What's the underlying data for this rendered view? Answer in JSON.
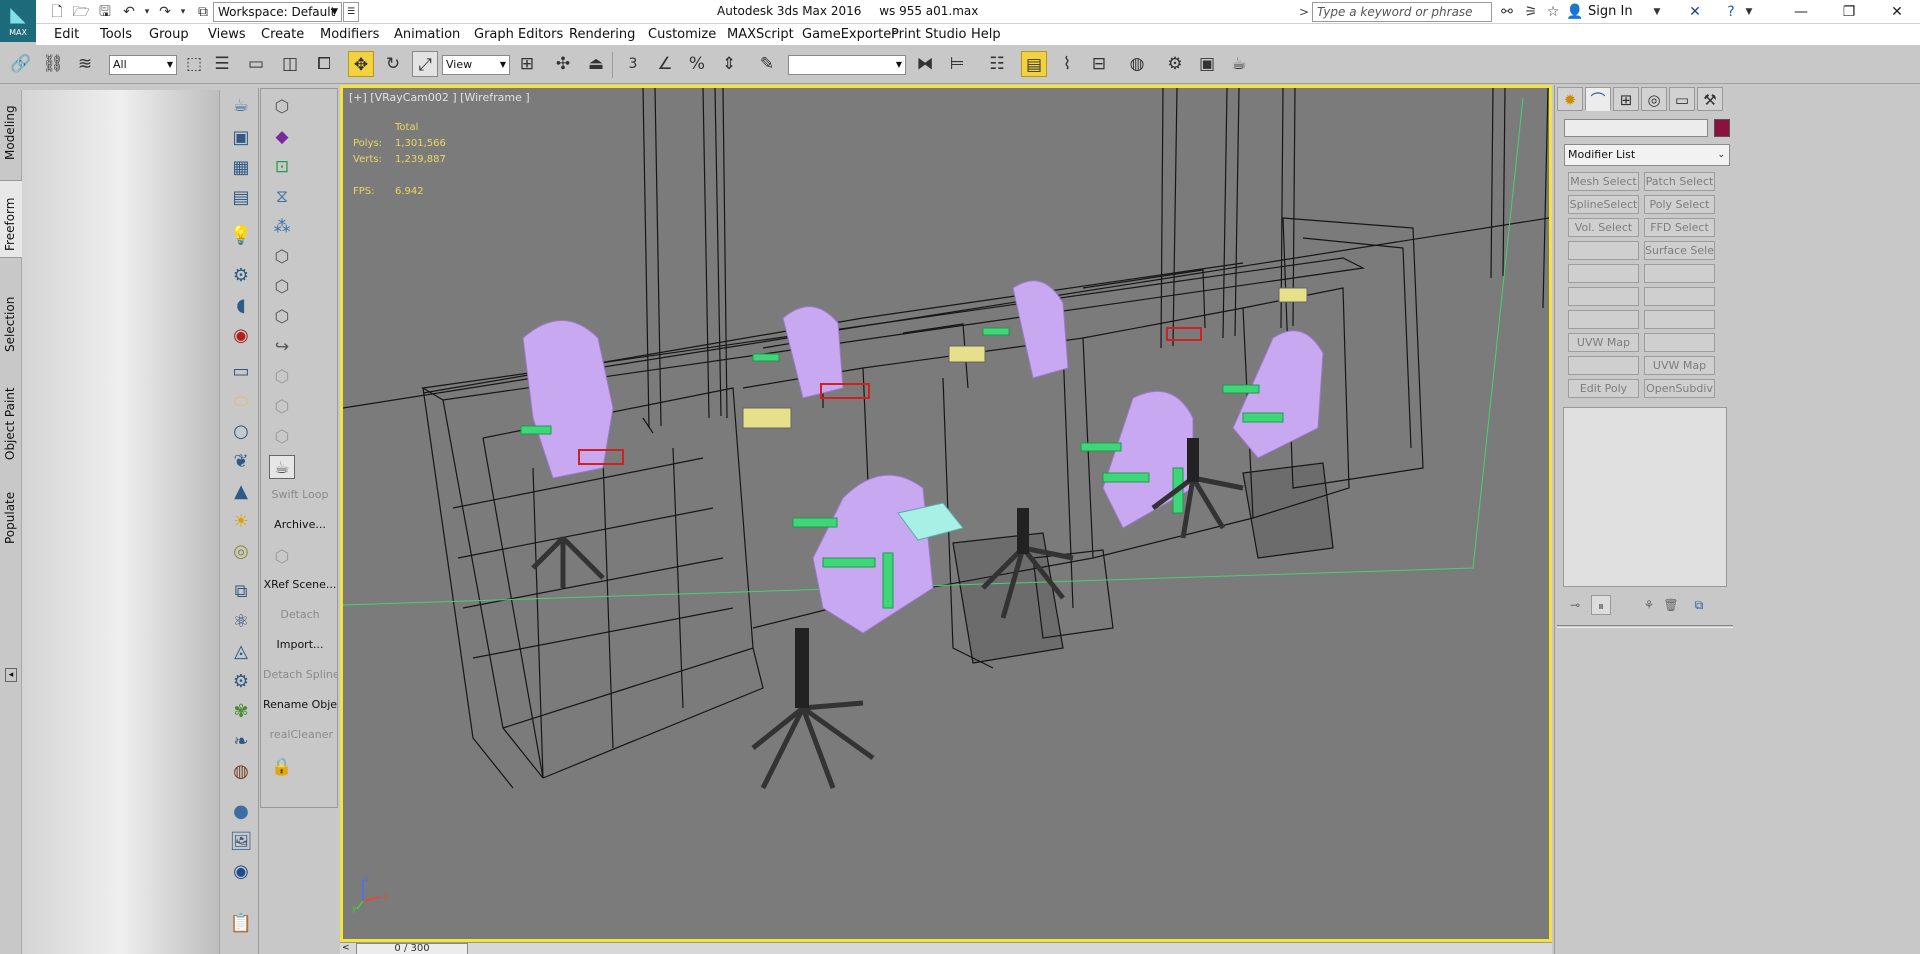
{
  "app": {
    "logo_text": "MAX",
    "workspace": "Workspace: Default",
    "title_app": "Autodesk 3ds Max 2016",
    "title_file": "ws 955 a01.max",
    "search_placeholder": "Type a keyword or phrase",
    "sign_in": "Sign In"
  },
  "menu": [
    "Edit",
    "Tools",
    "Group",
    "Views",
    "Create",
    "Modifiers",
    "Animation",
    "Graph Editors",
    "Rendering",
    "Customize",
    "MAXScript",
    "GameExporter",
    "Print Studio",
    "Help"
  ],
  "toolbar": {
    "selection_filter": "All",
    "ref_coord": "View",
    "named_selection": "",
    "snap_label": "3"
  },
  "ribbon_tabs": [
    "Modeling",
    "Freeform",
    "Selection",
    "Object Paint",
    "Populate"
  ],
  "command_column_b": {
    "labels": [
      "Swift Loop",
      "Archive...",
      "XRef Scene...",
      "Detach",
      "Import...",
      "Detach Spline",
      "Rename Objects",
      "realCleaner"
    ]
  },
  "viewport": {
    "label": "[+] [VRayCam002 ] [Wireframe ]",
    "stats_header": "Total",
    "polys_label": "Polys:",
    "polys_value": "1,301,566",
    "verts_label": "Verts:",
    "verts_value": "1,239,887",
    "fps_label": "FPS:",
    "fps_value": "6.942",
    "axis_x": "x",
    "axis_y": "y",
    "axis_z": "z"
  },
  "time_slider": {
    "value": "0 / 300"
  },
  "command_panel": {
    "modifier_list": "Modifier List",
    "object_color": "#8c1040",
    "buttons": [
      {
        "label": "Mesh Select"
      },
      {
        "label": "Patch Select"
      },
      {
        "label": "SplineSelect"
      },
      {
        "label": "Poly Select"
      },
      {
        "label": "Vol. Select"
      },
      {
        "label": "FFD Select"
      },
      {
        "label": ""
      },
      {
        "label": "Surface Select"
      },
      {
        "label": ""
      },
      {
        "label": ""
      },
      {
        "label": ""
      },
      {
        "label": ""
      },
      {
        "label": ""
      },
      {
        "label": ""
      },
      {
        "label": "UVW Map"
      },
      {
        "label": ""
      },
      {
        "label": ""
      },
      {
        "label": "UVW Map"
      },
      {
        "label": "Edit Poly"
      },
      {
        "label": "OpenSubdiv"
      }
    ]
  },
  "colors": {
    "viewport_bg": "#7b7b7b",
    "active_viewport_border": "#f2e43d",
    "chair_mesh": "#c8a8f0",
    "armrest": "#3fd67a",
    "stats_text": "#e8d860"
  }
}
